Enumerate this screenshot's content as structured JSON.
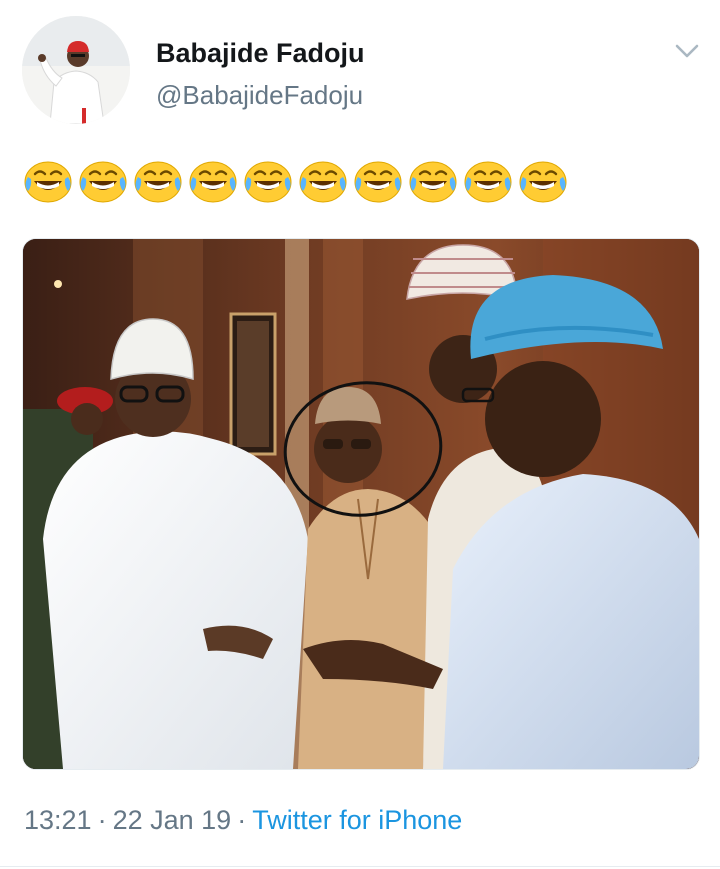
{
  "tweet": {
    "author": {
      "display_name": "Babajide Fadoju",
      "handle": "@BabajideFadoju",
      "avatar_icon": "user-avatar"
    },
    "text": {
      "emoji_name": "face-with-tears-of-joy",
      "emoji_count": 10
    },
    "media": {
      "type": "photo",
      "annotation": "hand-drawn black circle around a face"
    },
    "time": "13:21",
    "date": "22 Jan 19",
    "separator": "·",
    "source": "Twitter for iPhone"
  },
  "menu": {
    "icon": "chevron-down-icon"
  },
  "colors": {
    "text_primary": "#14171a",
    "text_secondary": "#657786",
    "link": "#1b95e0",
    "divider": "#e6ecf0"
  }
}
